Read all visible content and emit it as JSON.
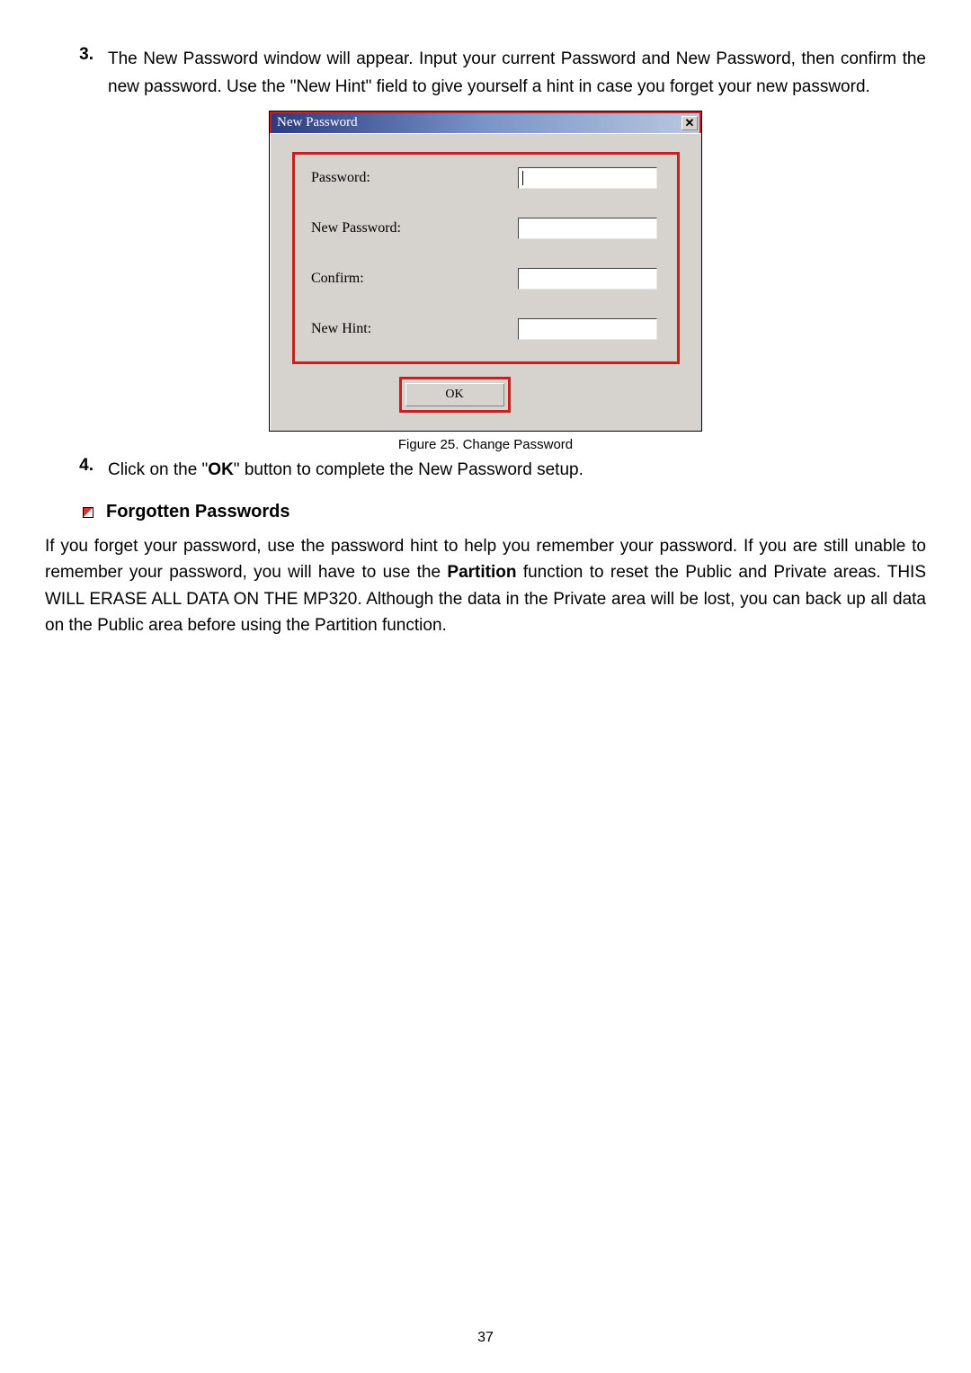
{
  "step3": {
    "num": "3.",
    "text": "The New Password window will appear. Input your current Password and New Password, then confirm the new password. Use the \"New Hint\" field to give yourself a hint in case you forget your new password."
  },
  "dialog": {
    "title": "New Password",
    "close": "✕",
    "fields": {
      "password": "Password:",
      "newPassword": "New Password:",
      "confirm": "Confirm:",
      "newHint": "New Hint:"
    },
    "ok": "OK"
  },
  "caption": "Figure 25. Change Password",
  "step4": {
    "num": "4.",
    "pre": "Click on the \"",
    "bold": "OK",
    "post": "\" button to complete the New Password setup."
  },
  "section": {
    "title": "Forgotten Passwords",
    "p_a": "If you forget your password, use the password hint to help you remember your password. If you are still unable to remember your password, you will have to use the ",
    "p_bold": "Partition",
    "p_b": " function to reset the Public and Private areas. THIS WILL ERASE ALL DATA ON THE MP320. Although the data in the Private area will be lost, you can back up all data on the Public area before using the Partition function."
  },
  "pageNumber": "37"
}
